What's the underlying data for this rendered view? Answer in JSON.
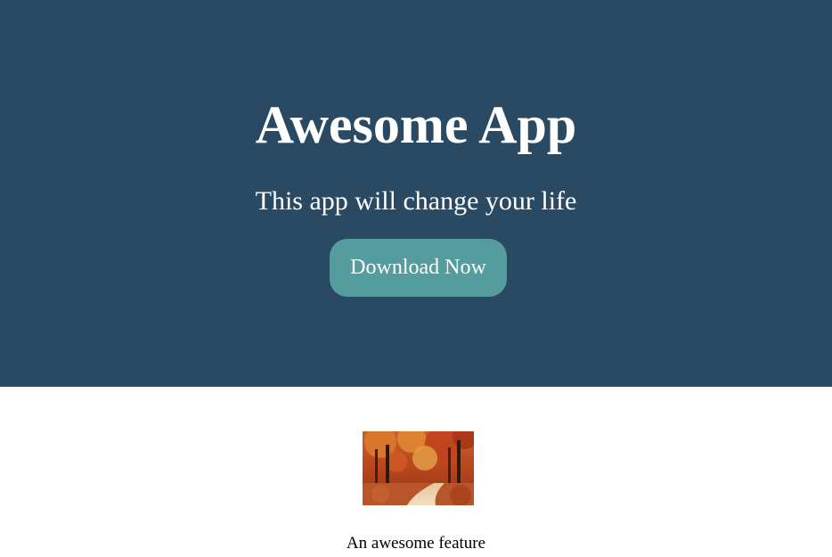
{
  "hero": {
    "title": "Awesome App",
    "subtitle": "This app will change your life",
    "button_label": "Download Now",
    "background_color": "#2a4a63",
    "button_color": "#559c9f"
  },
  "feature": {
    "image_alt": "autumn forest path",
    "caption": "An awesome feature"
  }
}
